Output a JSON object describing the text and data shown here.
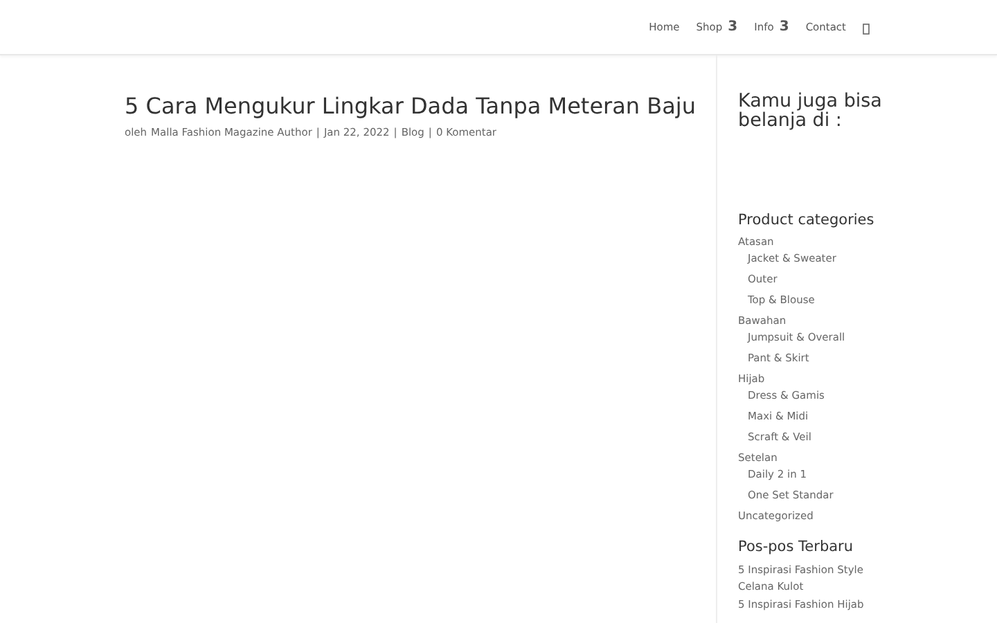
{
  "nav": {
    "items": [
      {
        "label": "Home"
      },
      {
        "label": "Shop",
        "dropdown": "3"
      },
      {
        "label": "Info",
        "dropdown": "3"
      },
      {
        "label": "Contact"
      }
    ]
  },
  "post": {
    "title": "5 Cara Mengukur Lingkar Dada Tanpa Meteran Baju",
    "byline": "oleh",
    "author": "Malla Fashion Magazine Author",
    "separator_1": "|",
    "date": "Jan 22, 2022",
    "separator_2": "|",
    "category": "Blog",
    "separator_3": "|",
    "comments": "0 Komentar"
  },
  "sidebar": {
    "promo_title": "Kamu juga bisa belanja di :",
    "categories": {
      "title": "Product categories",
      "items": [
        {
          "label": "Atasan",
          "children": [
            {
              "label": "Jacket & Sweater"
            },
            {
              "label": "Outer"
            },
            {
              "label": "Top & Blouse"
            }
          ]
        },
        {
          "label": "Bawahan",
          "children": [
            {
              "label": "Jumpsuit & Overall"
            },
            {
              "label": "Pant & Skirt"
            }
          ]
        },
        {
          "label": "Hijab",
          "children": [
            {
              "label": "Dress & Gamis"
            },
            {
              "label": "Maxi & Midi"
            },
            {
              "label": "Scraft & Veil"
            }
          ]
        },
        {
          "label": "Setelan",
          "children": [
            {
              "label": "Daily 2 in 1"
            },
            {
              "label": "One Set Standar"
            }
          ]
        },
        {
          "label": "Uncategorized"
        }
      ]
    },
    "recent": {
      "title": "Pos-pos Terbaru",
      "items": [
        {
          "label": "5 Inspirasi Fashion Style Celana Kulot"
        },
        {
          "label": "5 Inspirasi Fashion Hijab"
        }
      ]
    }
  }
}
